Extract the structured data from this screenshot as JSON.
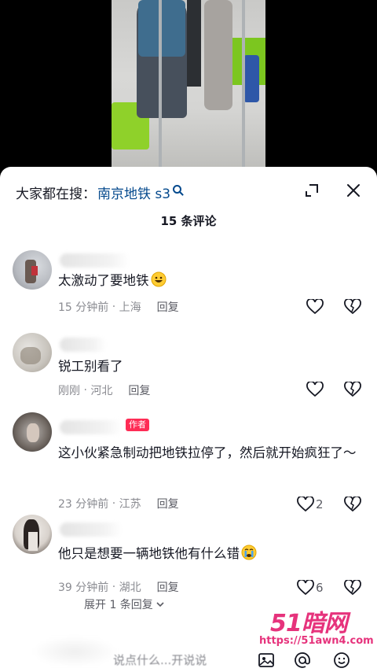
{
  "header": {
    "search_prefix": "大家都在搜：",
    "search_term": "南京地铁 s3",
    "comment_count_title": "15 条评论"
  },
  "comments": [
    {
      "text": "太激动了要地铁",
      "emoji": "grinning-face",
      "time": "15 分钟前",
      "location": "上海",
      "reply_label": "回复",
      "likes": ""
    },
    {
      "text": "锐工别看了",
      "time": "刚刚",
      "location": "河北",
      "reply_label": "回复",
      "likes": ""
    },
    {
      "text": "这小伙紧急制动把地铁拉停了，然后就开始疯狂了～",
      "author_tag": "作者",
      "time": "23 分钟前",
      "location": "江苏",
      "reply_label": "回复",
      "likes": "2"
    },
    {
      "text": "他只是想要一辆地铁他有什么错",
      "emoji": "crying-face",
      "time": "39 分钟前",
      "location": "湖北",
      "reply_label": "回复",
      "likes": "6"
    }
  ],
  "expand_replies": "展开 1 条回复",
  "input": {
    "placeholder": "说点什么...开说说"
  },
  "watermark": {
    "title": "51暗网",
    "url": "https://51awn4.com"
  },
  "colors": {
    "accent_link": "#04498d",
    "author_tag": "#fe2c55",
    "meta_gray": "#8a8b91",
    "watermark": "#e6337c"
  }
}
